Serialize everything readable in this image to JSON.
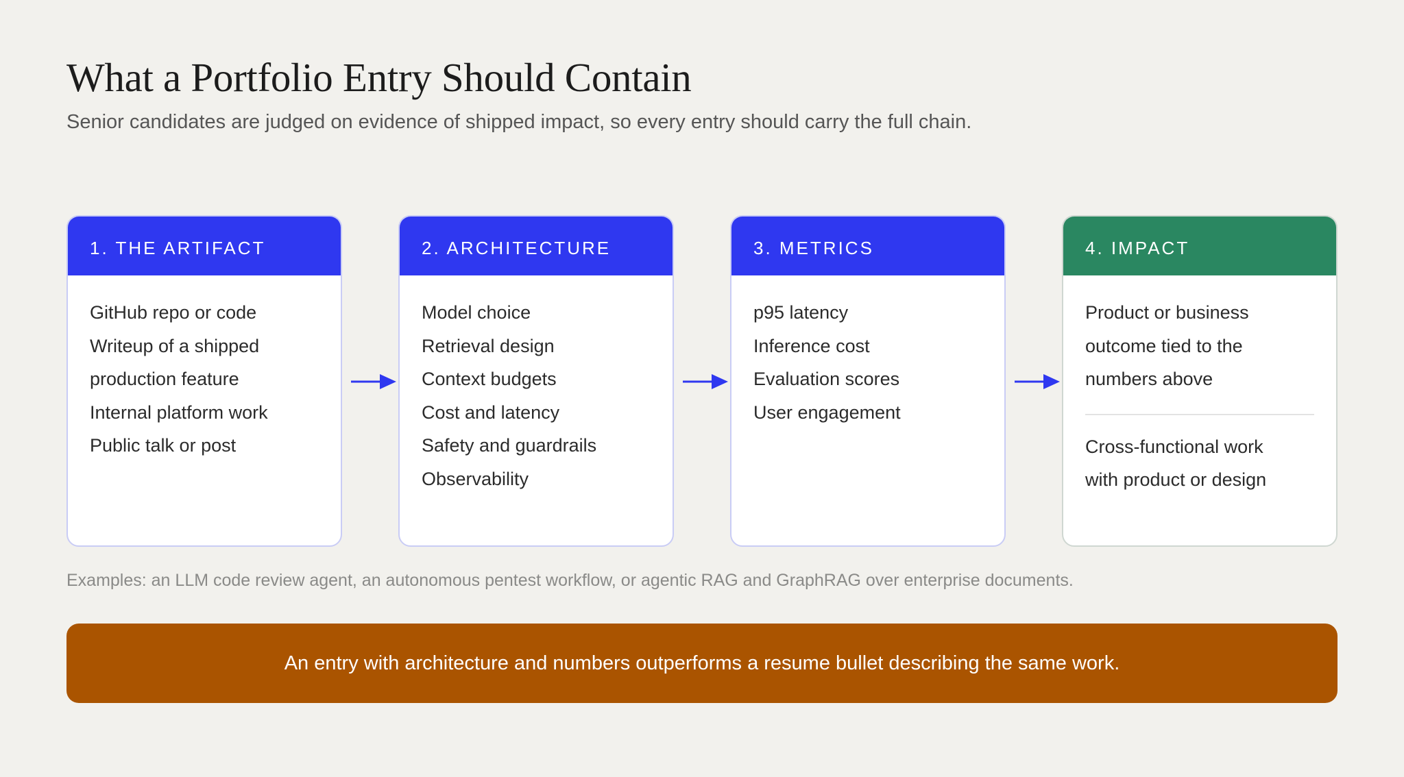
{
  "header": {
    "title": "What a Portfolio Entry Should Contain",
    "subtitle": "Senior candidates are judged on evidence of shipped impact, so every entry should carry the full chain."
  },
  "cards": [
    {
      "title": "1. THE ARTIFACT",
      "items": [
        "GitHub repo or code",
        "Writeup of a shipped",
        "production feature",
        "Internal platform work",
        "Public talk or post"
      ]
    },
    {
      "title": "2. ARCHITECTURE",
      "items": [
        "Model choice",
        "Retrieval design",
        "Context budgets",
        "Cost and latency",
        "Safety and guardrails",
        "Observability"
      ]
    },
    {
      "title": "3. METRICS",
      "items": [
        "p95 latency",
        "Inference cost",
        "Evaluation scores",
        "User engagement"
      ]
    },
    {
      "title": "4. IMPACT",
      "items": [
        "Product or business",
        "outcome tied to the",
        "numbers above"
      ],
      "secondary_items": [
        "Cross-functional work",
        "with product or design"
      ]
    }
  ],
  "examples": "Examples: an LLM code review agent, an autonomous pentest workflow, or agentic RAG and GraphRAG over enterprise documents.",
  "banner": "An entry with architecture and numbers outperforms a resume bullet describing the same work.",
  "colors": {
    "background": "#f2f1ed",
    "blue_header": "#2f38f0",
    "green_header": "#2a8761",
    "banner": "#aa5400",
    "arrow": "#2f38f0"
  },
  "icons": {
    "connector": "arrow-right-icon"
  }
}
